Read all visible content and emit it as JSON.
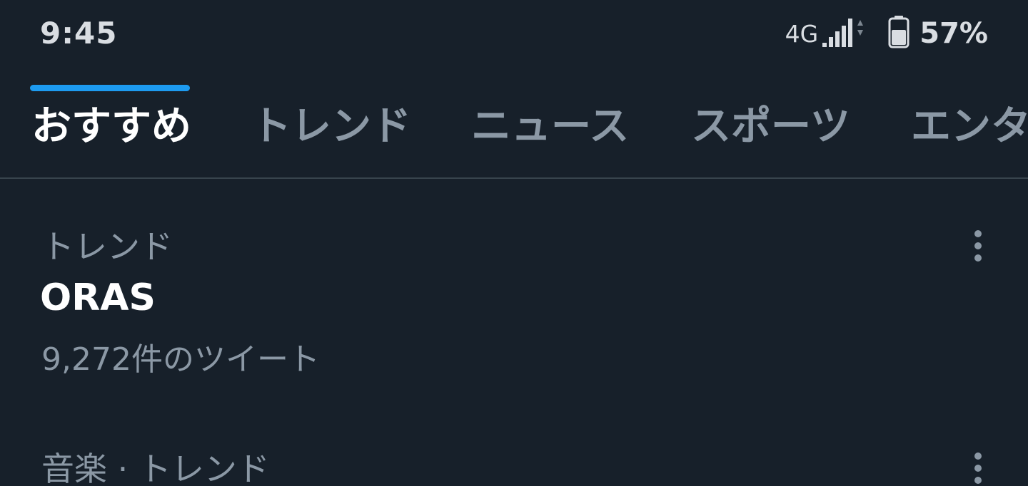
{
  "status_bar": {
    "time": "9:45",
    "network": "4G",
    "battery_percent": "57%",
    "icons": [
      "signal-icon",
      "battery-icon"
    ]
  },
  "tabs": [
    {
      "label": "おすすめ",
      "active": true
    },
    {
      "label": "トレンド",
      "active": false
    },
    {
      "label": "ニュース",
      "active": false
    },
    {
      "label": "スポーツ",
      "active": false
    },
    {
      "label": "エンタ",
      "active": false
    }
  ],
  "colors": {
    "background": "#17202a",
    "accent": "#1d9bf0",
    "secondary_text": "#8b98a5",
    "divider": "#38444d"
  },
  "trends": [
    {
      "context": "トレンド",
      "title": "ORAS",
      "count": "9,272件のツイート",
      "icon": "more-vertical-icon"
    },
    {
      "context": "音楽 · トレンド",
      "icon": "more-vertical-icon"
    }
  ]
}
